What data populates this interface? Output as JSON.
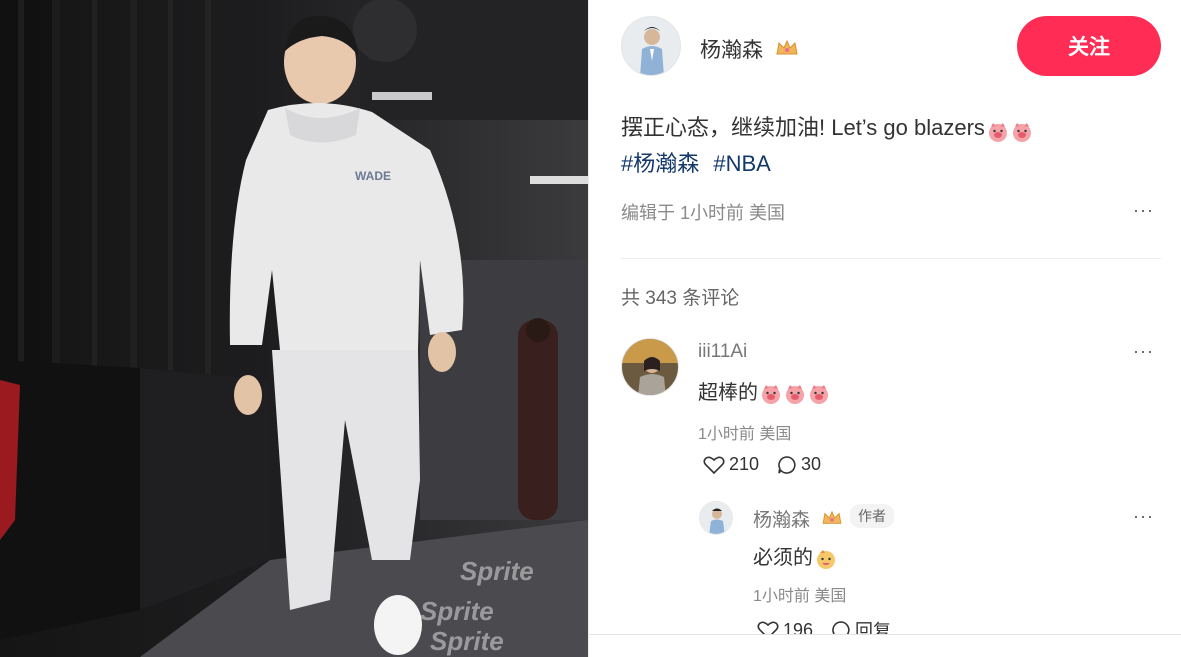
{
  "photo": {
    "alt_icon": "basketball-player-photo"
  },
  "author": {
    "name": "杨瀚森",
    "badge_icon": "crown-icon",
    "follow_label": "关注",
    "follow_color": "#ff2c55"
  },
  "post": {
    "text": "摆正心态，继续加油! Let’s go blazers",
    "emoji_icons": [
      "pig-face-icon",
      "pig-face-icon"
    ],
    "tags": [
      "#杨瀚森",
      "#NBA"
    ],
    "meta": "编辑于 1小时前 美国",
    "more_label": "···"
  },
  "comments": {
    "count_label": "共 343 条评论",
    "items": [
      {
        "user": "iii11Ai",
        "text": "超棒的",
        "emoji_icons": [
          "pig-face-icon",
          "pig-face-icon",
          "pig-face-icon"
        ],
        "meta": "1小时前 美国",
        "likes": "210",
        "replies": "30",
        "more_label": "···"
      }
    ],
    "reply": {
      "user": "杨瀚森",
      "badge_icon": "crown-icon",
      "author_badge": "作者",
      "text": "必须的",
      "emoji_icon": "cheer-face-icon",
      "meta": "1小时前 美国",
      "likes": "196",
      "reply_label": "回复",
      "more_label": "···"
    }
  },
  "colors": {
    "tag": "#13386c",
    "accent": "#ff2c55",
    "meta": "#8a8a8a"
  }
}
